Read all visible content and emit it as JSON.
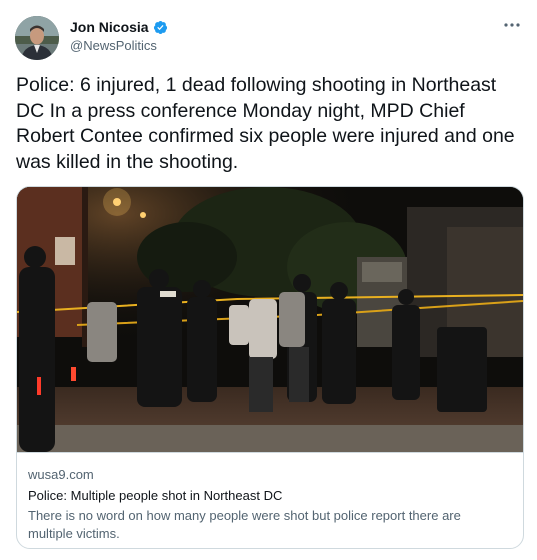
{
  "author": {
    "display_name": "Jon Nicosia",
    "handle": "@NewsPolitics",
    "verified": true
  },
  "tweet": {
    "text": "Police: 6 injured, 1 dead following shooting in Northeast DC In a press conference Monday night, MPD Chief Robert Contee confirmed six people were injured and one was killed in the shooting."
  },
  "card": {
    "domain": "wusa9.com",
    "title": "Police: Multiple people shot in Northeast DC",
    "description": "There is no word on how many people were shot but police report there are multiple victims.",
    "image_subject": "night-crime-scene-photo"
  },
  "icons": {
    "verified": "verified-badge-icon",
    "more": "more-options-icon"
  },
  "colors": {
    "verified_blue": "#1d9bf0",
    "text_primary": "#0f1419",
    "text_secondary": "#536471",
    "border": "#cfd9de",
    "police_tape": "#e9b020"
  }
}
